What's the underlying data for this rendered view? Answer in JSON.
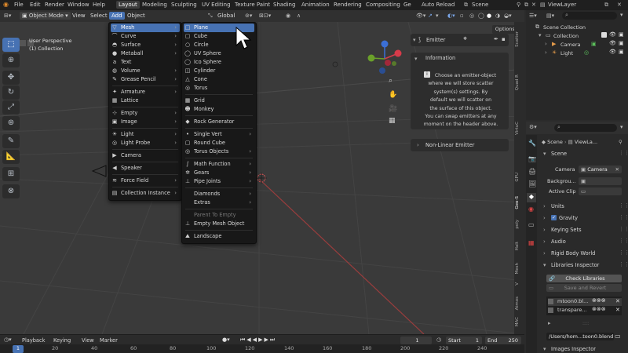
{
  "top_menu": [
    "File",
    "Edit",
    "Render",
    "Window",
    "Help"
  ],
  "workspaces": [
    "Layout",
    "Modeling",
    "Sculpting",
    "UV Editing",
    "Texture Paint",
    "Shading",
    "Animation",
    "Rendering",
    "Compositing",
    "Ge"
  ],
  "auto_reload": "Auto Reload",
  "scene_name": "Scene",
  "view_layer": "ViewLayer",
  "header": {
    "mode": "Object Mode",
    "view": "View",
    "select": "Select",
    "add": "Add",
    "object": "Object",
    "orientation": "Global",
    "options": "Options"
  },
  "viewport": {
    "line1": "User Perspective",
    "line2": "(1) Collection"
  },
  "add_menu": [
    {
      "label": "Mesh",
      "icon": "▽"
    },
    {
      "label": "Curve",
      "icon": "⌒"
    },
    {
      "label": "Surface",
      "icon": "◓"
    },
    {
      "label": "Metaball",
      "icon": "●"
    },
    {
      "label": "Text",
      "icon": "a"
    },
    {
      "label": "Volume",
      "icon": "◍"
    },
    {
      "label": "Grease Pencil",
      "icon": "✎"
    },
    {
      "label": "Armature",
      "icon": "✦"
    },
    {
      "label": "Lattice",
      "icon": "▦"
    },
    {
      "label": "Empty",
      "icon": "⊹"
    },
    {
      "label": "Image",
      "icon": "▣"
    },
    {
      "label": "Light",
      "icon": "☀"
    },
    {
      "label": "Light Probe",
      "icon": "◎"
    },
    {
      "label": "Camera",
      "icon": "▶"
    },
    {
      "label": "Speaker",
      "icon": "◀"
    },
    {
      "label": "Force Field",
      "icon": "≋"
    },
    {
      "label": "Collection Instance",
      "icon": "▤"
    }
  ],
  "mesh_menu": [
    {
      "label": "Plane",
      "icon": "□"
    },
    {
      "label": "Cube",
      "icon": "▢"
    },
    {
      "label": "Circle",
      "icon": "○"
    },
    {
      "label": "UV Sphere",
      "icon": "◯"
    },
    {
      "label": "Ico Sphere",
      "icon": "◯"
    },
    {
      "label": "Cylinder",
      "icon": "◫"
    },
    {
      "label": "Cone",
      "icon": "△"
    },
    {
      "label": "Torus",
      "icon": "◎"
    },
    {
      "label": "Grid",
      "icon": "▦"
    },
    {
      "label": "Monkey",
      "icon": "☻"
    },
    {
      "label": "Rock Generator",
      "icon": "◆"
    },
    {
      "label": "Single Vert",
      "icon": "•"
    },
    {
      "label": "Round Cube",
      "icon": "▢"
    },
    {
      "label": "Torus Objects",
      "icon": "◎"
    },
    {
      "label": "Math Function",
      "icon": "∫"
    },
    {
      "label": "Gears",
      "icon": "✲"
    },
    {
      "label": "Pipe Joints",
      "icon": "⊥"
    },
    {
      "label": "Diamonds",
      "icon": ""
    },
    {
      "label": "Extras",
      "icon": ""
    },
    {
      "label": "Parent To Empty",
      "icon": ""
    },
    {
      "label": "Empty Mesh Object",
      "icon": "⊥"
    },
    {
      "label": "Landscape",
      "icon": "⛰"
    }
  ],
  "emitter": {
    "title": "Emitter",
    "info_title": "Information",
    "info_lines": [
      "Choose an emitter-object",
      "where we will store scatter",
      "system(s) settings. By",
      "default we will scatter on",
      "the surface of this object.",
      "You can swap emitters at any",
      "moment on the header above."
    ],
    "nonlinear": "Non-Linear Emitter"
  },
  "side_tabs": [
    "Scatter",
    "Quad R",
    "VirtuC",
    "GPU",
    "Geo-S",
    "poly",
    "Halt",
    "Mesh",
    "V",
    "Atmos",
    "MAC"
  ],
  "outliner": {
    "root": "Scene Collection",
    "items": [
      "Collection",
      "Camera",
      "Light"
    ]
  },
  "properties": {
    "breadcrumb": [
      "Scene",
      "ViewLa..."
    ],
    "section_scene": "Scene",
    "camera_label": "Camera",
    "camera_value": "Camera",
    "background_label": "Backgrou...",
    "active_clip_label": "Active Clip",
    "sections": [
      "Units",
      "Gravity",
      "Keying Sets",
      "Audio",
      "Rigid Body World",
      "Libraries Inspector"
    ],
    "check_libraries": "Check Libraries",
    "save_revert": "Save and Revert",
    "lib_rows": [
      "mtoon0.bl...",
      "transpare..."
    ],
    "filepath": "/Users/hom...toon0.blend",
    "images_inspector": "Images Inspector"
  },
  "timeline": {
    "playback": "Playback",
    "keying": "Keying",
    "view": "View",
    "marker": "Marker",
    "frame": "1",
    "start_label": "Start",
    "start": "1",
    "end_label": "End",
    "end": "250"
  },
  "ruler": [
    "1",
    "20",
    "40",
    "60",
    "80",
    "100",
    "120",
    "140",
    "160",
    "180",
    "200",
    "220",
    "240"
  ]
}
